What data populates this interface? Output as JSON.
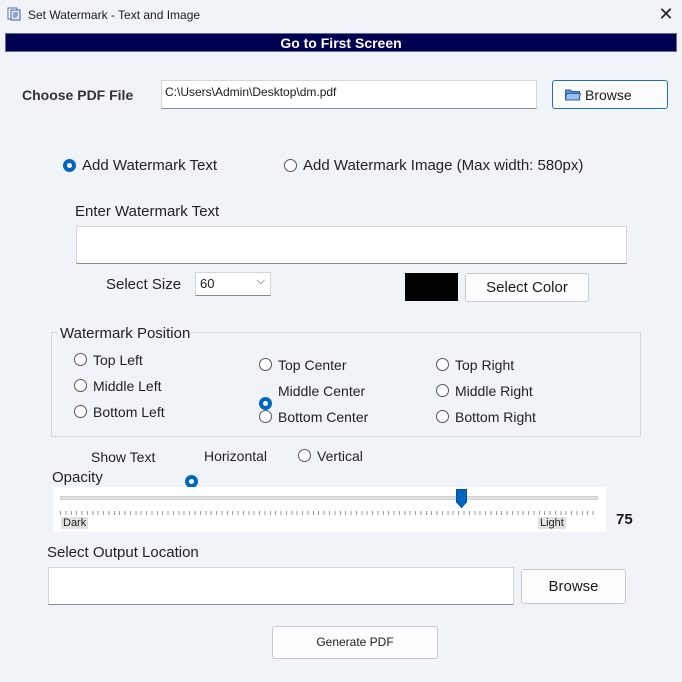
{
  "window": {
    "title": "Set Watermark  - Text and Image",
    "close_glyph": "✕"
  },
  "toolbar": {
    "first_screen_label": "Go to First Screen"
  },
  "file": {
    "label": "Choose PDF File",
    "path": "C:\\Users\\Admin\\Desktop\\dm.pdf",
    "browse_label": "Browse"
  },
  "mode": {
    "text_label": "Add Watermark Text",
    "image_label": "Add Watermark Image (Max width: 580px)",
    "selected": "text"
  },
  "watermark_text": {
    "label": "Enter Watermark Text",
    "value": ""
  },
  "size": {
    "label": "Select Size",
    "value": "60",
    "chevron": "⌵"
  },
  "color": {
    "swatch": "#000000",
    "button_label": "Select Color"
  },
  "position": {
    "title": "Watermark Position",
    "options": [
      "Top Left",
      "Top Center",
      "Top Right",
      "Middle Left",
      "Middle Center",
      "Middle Right",
      "Bottom Left",
      "Bottom Center",
      "Bottom Right"
    ],
    "selected": "Middle Center"
  },
  "orientation": {
    "label": "Show Text",
    "horizontal": "Horizontal",
    "vertical": "Vertical",
    "selected": "Horizontal"
  },
  "opacity": {
    "label": "Opacity",
    "value": "75",
    "fraction": 0.75,
    "dark_label": "Dark",
    "light_label": "Light"
  },
  "output": {
    "label": "Select Output Location",
    "value": "",
    "browse_label": "Browse"
  },
  "generate_label": "Generate PDF",
  "accent": "#0067c0",
  "header_color": "#000050"
}
